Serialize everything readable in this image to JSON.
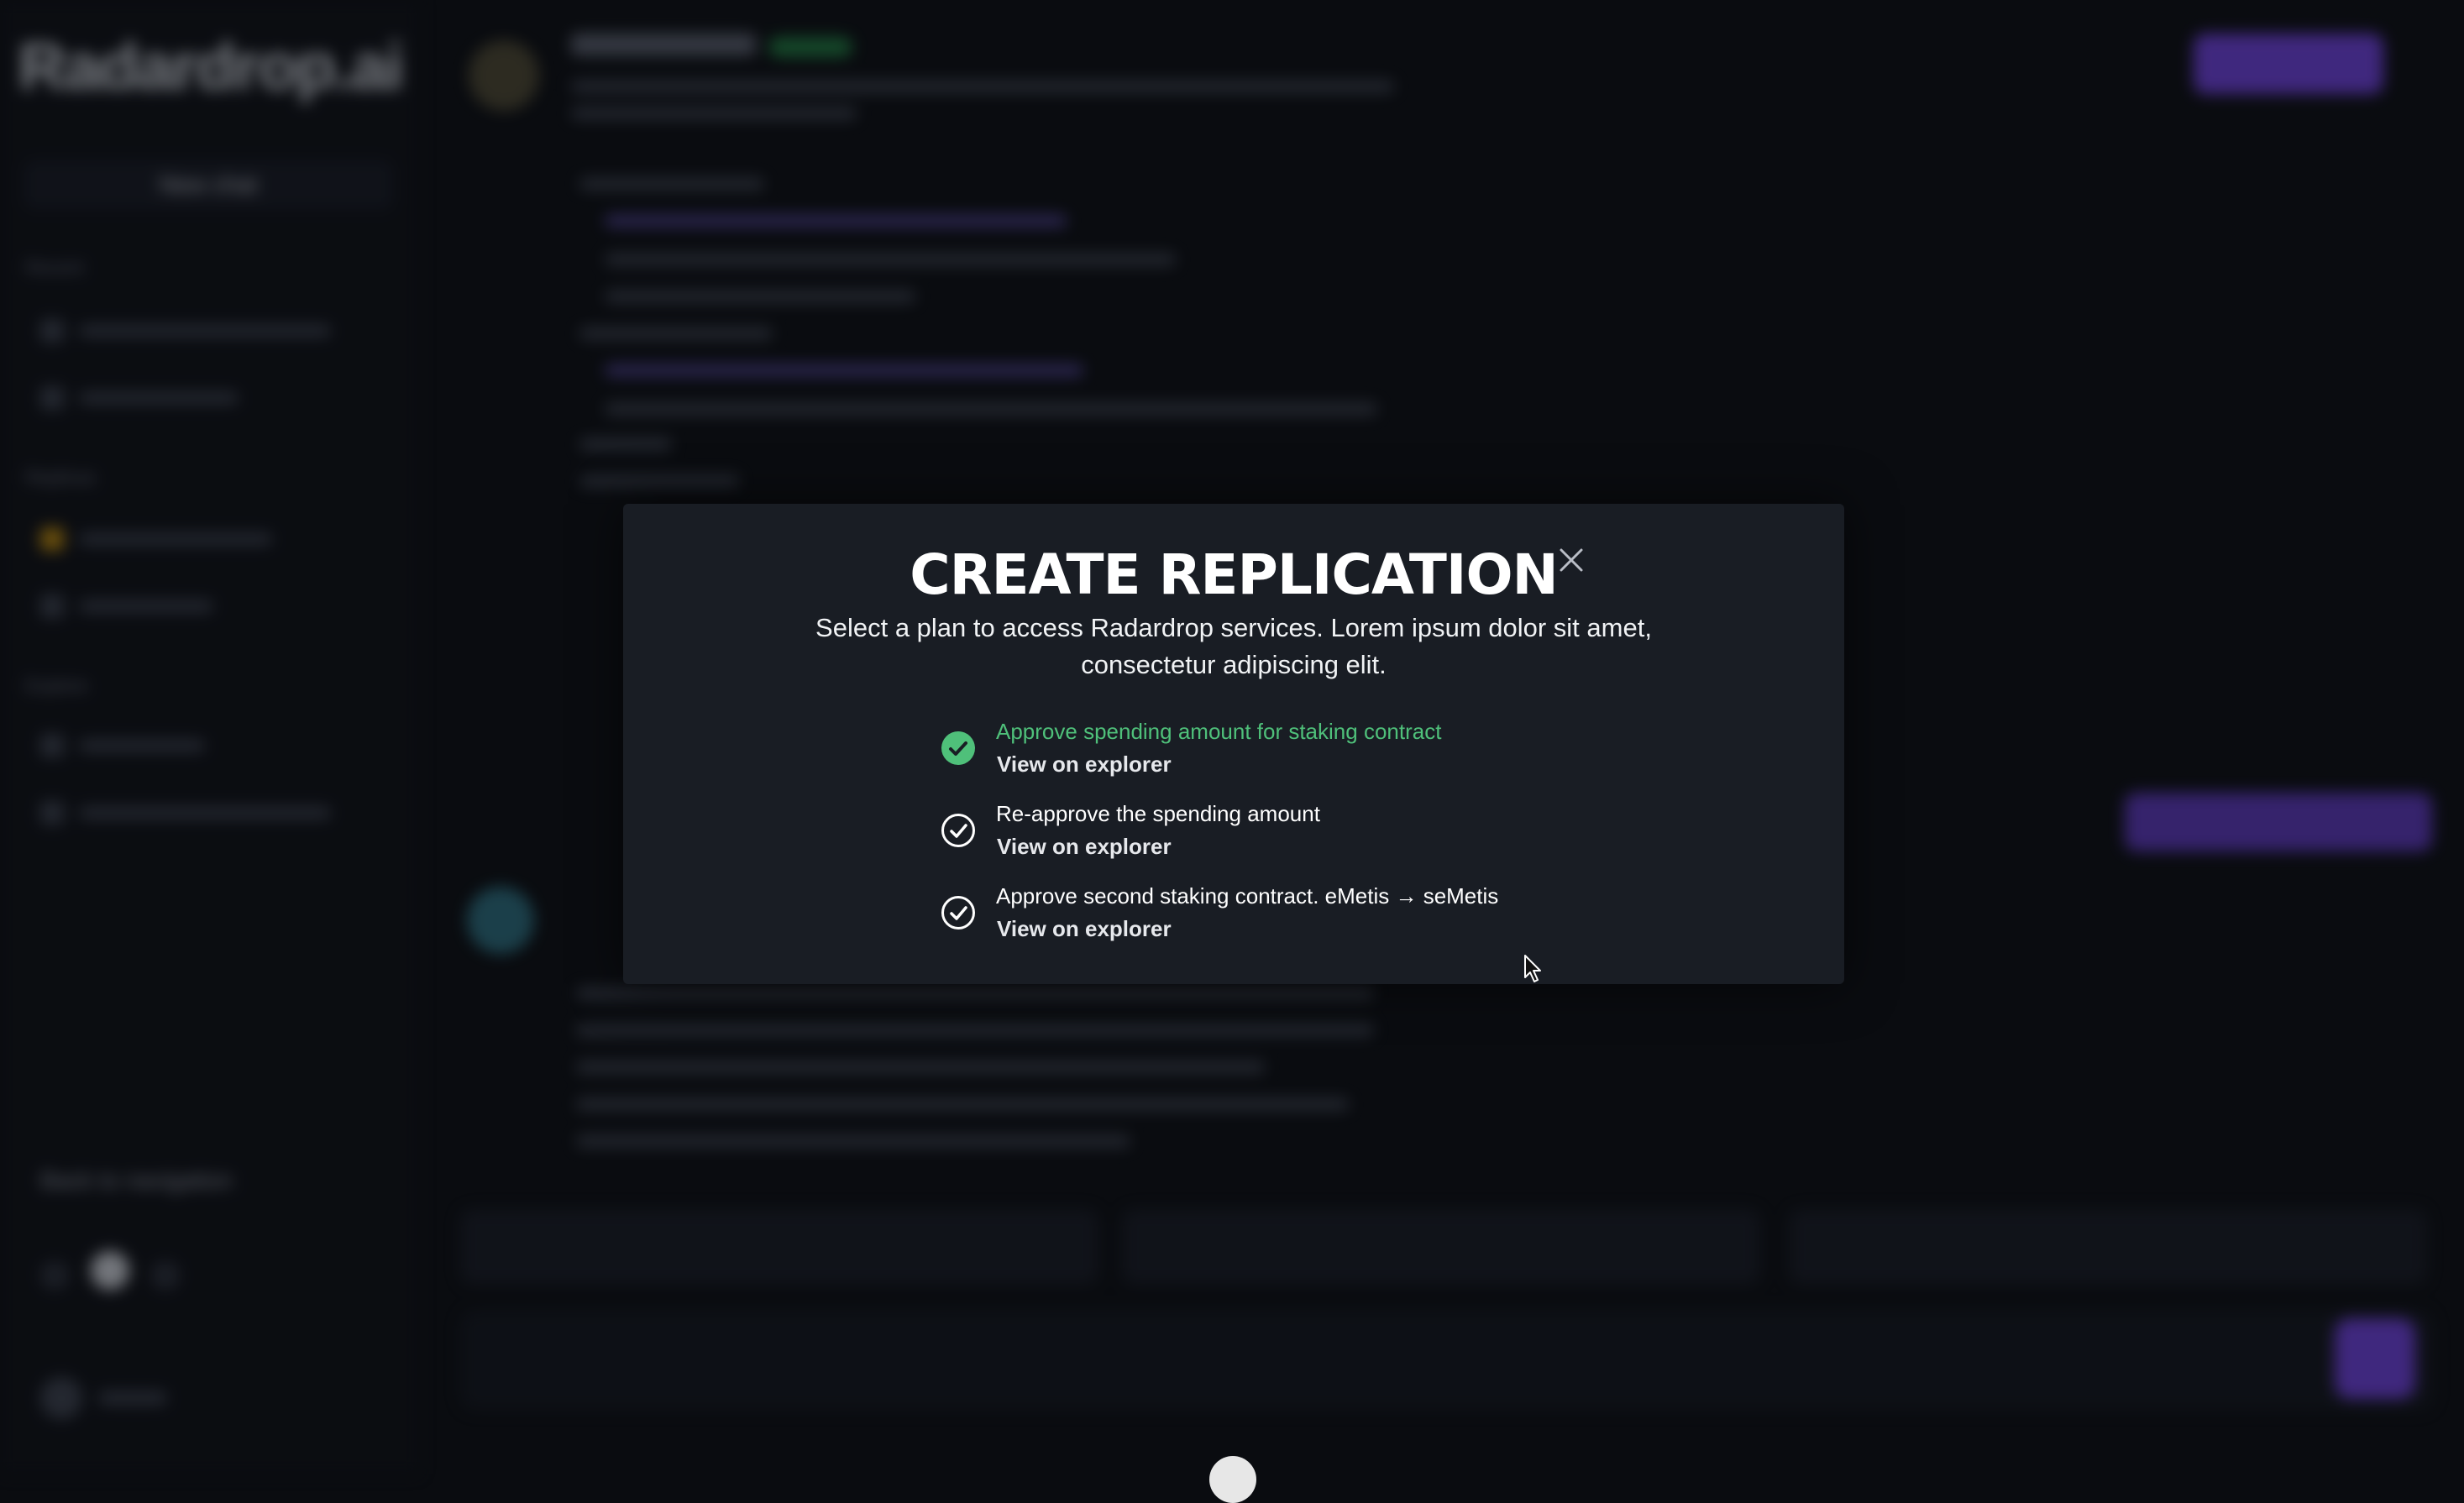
{
  "app": {
    "brand": "Radardrop.ai",
    "new_chat": "New chat",
    "sidebar_sections": [
      "Recent",
      "Replicas",
      "Explore"
    ],
    "back_link": "Back to navigation"
  },
  "modal": {
    "title": "CREATE REPLICATION",
    "subtitle": "Select a plan to access Radardrop services. Lorem ipsum dolor sit amet, consectetur adipiscing elit.",
    "steps": [
      {
        "label": "Approve spending amount for staking contract",
        "link": "View on explorer",
        "status": "completed",
        "color": "#4fc07a"
      },
      {
        "label": "Re-approve the spending amount",
        "link": "View on explorer",
        "status": "pending"
      },
      {
        "label": "Approve second staking contract. eMetis → seMetis",
        "link": "View on explorer",
        "status": "pending"
      }
    ],
    "close_icon": "close-icon"
  },
  "colors": {
    "accent": "#6c3fd8",
    "success": "#4fc07a",
    "modal_bg": "#191d24",
    "page_bg": "#0a0c10"
  }
}
